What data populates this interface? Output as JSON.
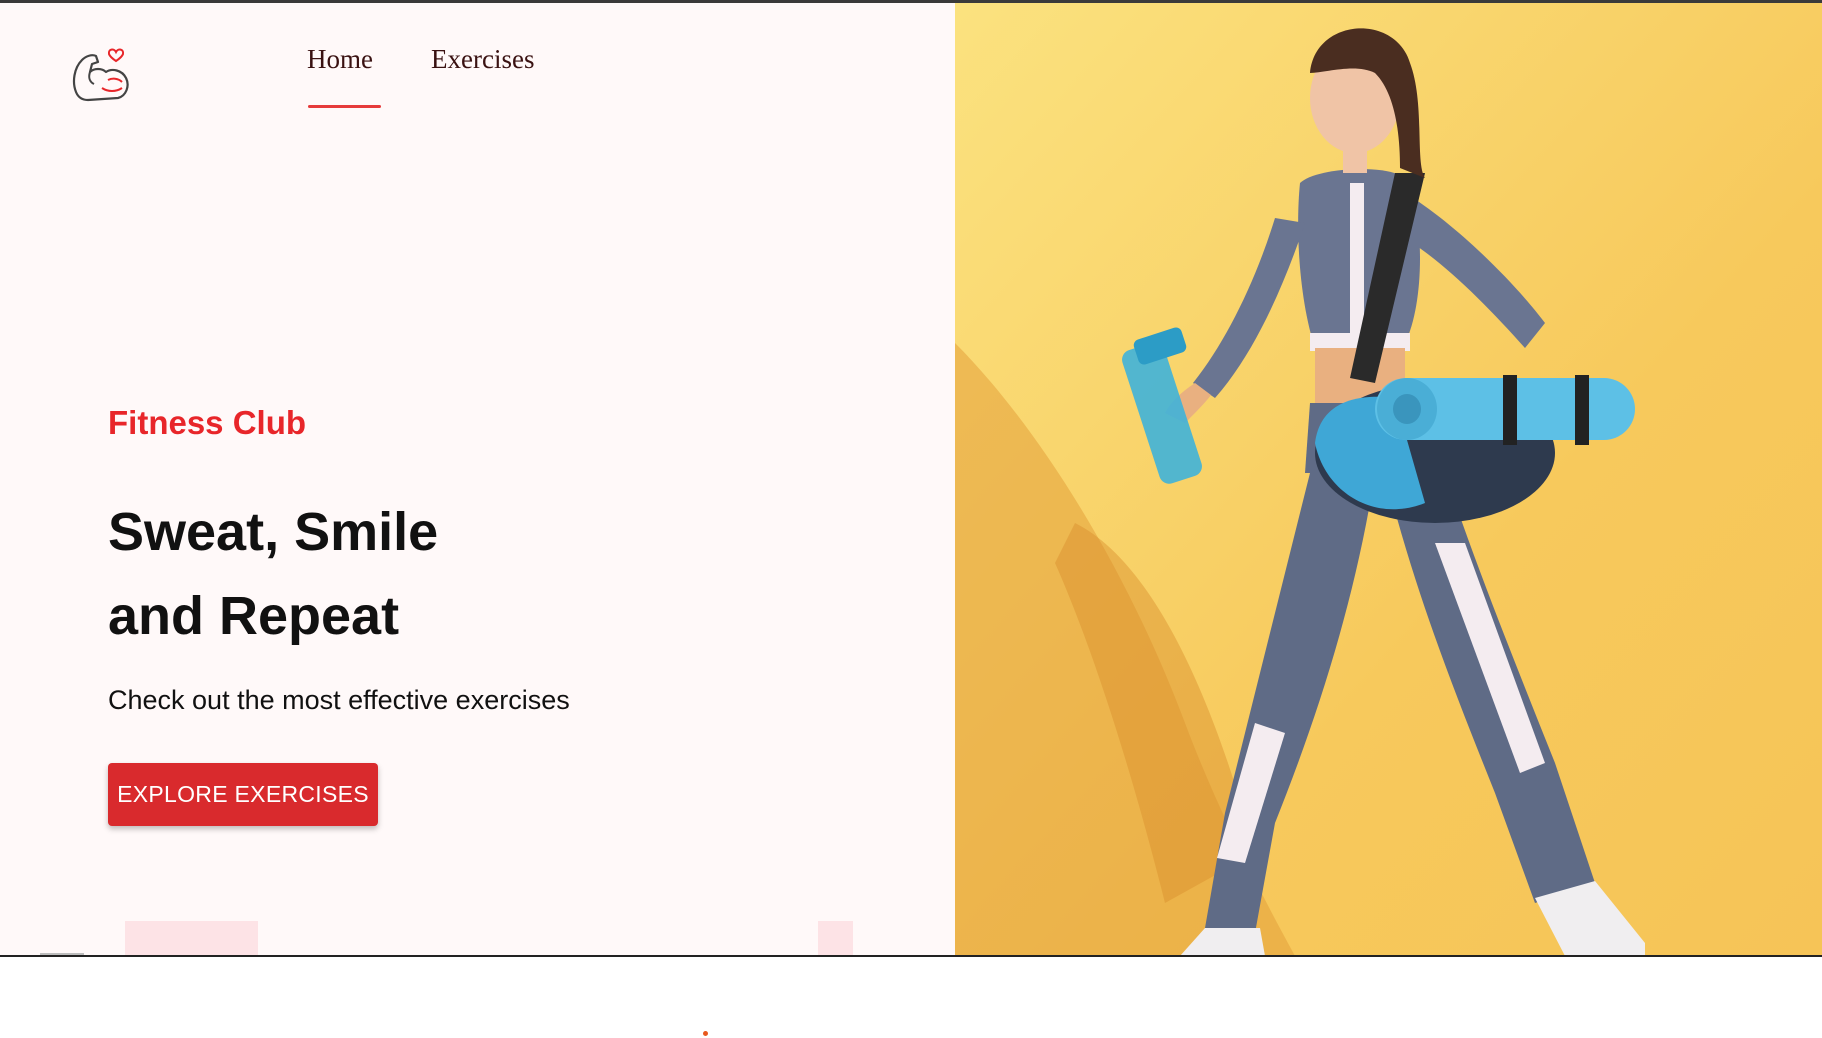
{
  "nav": {
    "items": [
      {
        "label": "Home",
        "active": true
      },
      {
        "label": "Exercises",
        "active": false
      }
    ],
    "logo_icon": "flexed-arm-heart-icon"
  },
  "hero": {
    "tag": "Fitness Club",
    "headline_line1": "Sweat, Smile",
    "headline_line2": "and Repeat",
    "subtext": "Check out the most effective exercises",
    "cta_label": "EXPLORE EXERCISES",
    "image": "woman-with-yoga-mat-and-shaker-photo"
  },
  "colors": {
    "accent": "#e8262a",
    "button": "#d92a2d",
    "hero_bg": "#fff9f9",
    "photo_bg": "#f8d46f"
  }
}
